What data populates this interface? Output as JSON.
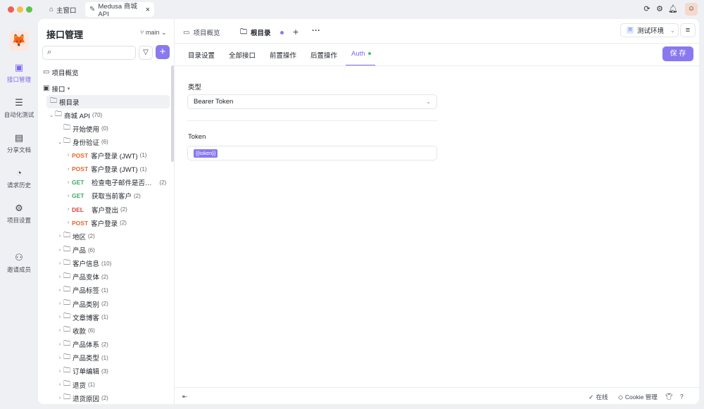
{
  "window": {
    "tabs": [
      {
        "label": "主窗口"
      },
      {
        "label": "Medusa 商城 API"
      }
    ]
  },
  "rail": {
    "items": [
      {
        "label": "接口管理"
      },
      {
        "label": "自动化测试"
      },
      {
        "label": "分享文档"
      },
      {
        "label": "请求历史"
      },
      {
        "label": "项目设置"
      },
      {
        "label": "邀请成员"
      }
    ]
  },
  "sidebar": {
    "title": "接口管理",
    "branch": "main",
    "search_placeholder": "",
    "overview_label": "项目概览",
    "interfaces_label": "接口",
    "root_label": "根目录",
    "tree": [
      {
        "label": "商城 API",
        "count": "(70)"
      },
      {
        "label": "开始使用",
        "count": "(0)"
      },
      {
        "label": "身份验证",
        "count": "(6)"
      },
      {
        "method": "POST",
        "label": "客户登录 (JWT)",
        "count": "(1)"
      },
      {
        "method": "POST",
        "label": "客户登录 (JWT)",
        "count": "(1)"
      },
      {
        "method": "GET",
        "label": "检查电子邮件是否…",
        "count": "(2)"
      },
      {
        "method": "GET",
        "label": "获取当前客户",
        "count": "(2)"
      },
      {
        "method": "DEL",
        "label": "客户登出",
        "count": "(2)"
      },
      {
        "method": "POST",
        "label": "客户登录",
        "count": "(2)"
      },
      {
        "label": "地区",
        "count": "(2)"
      },
      {
        "label": "产品",
        "count": "(6)"
      },
      {
        "label": "客户信息",
        "count": "(10)"
      },
      {
        "label": "产品变体",
        "count": "(2)"
      },
      {
        "label": "产品标签",
        "count": "(1)"
      },
      {
        "label": "产品类别",
        "count": "(2)"
      },
      {
        "label": "文章博客",
        "count": "(1)"
      },
      {
        "label": "收款",
        "count": "(6)"
      },
      {
        "label": "产品体系",
        "count": "(2)"
      },
      {
        "label": "产品类型",
        "count": "(1)"
      },
      {
        "label": "订单编辑",
        "count": "(3)"
      },
      {
        "label": "退货",
        "count": "(1)"
      },
      {
        "label": "退货原因",
        "count": "(2)"
      }
    ]
  },
  "main": {
    "tabs": [
      {
        "label": "项目概览"
      },
      {
        "label": "根目录"
      }
    ],
    "env": "测试环境",
    "subtabs": [
      {
        "label": "目录设置"
      },
      {
        "label": "全部接口"
      },
      {
        "label": "前置操作"
      },
      {
        "label": "后置操作"
      },
      {
        "label": "Auth"
      }
    ],
    "save_label": "保 存",
    "type_label": "类型",
    "type_value": "Bearer Token",
    "token_label": "Token",
    "token_value": "{{token}}"
  },
  "footer": {
    "online": "在线",
    "cookie": "Cookie 管理"
  }
}
